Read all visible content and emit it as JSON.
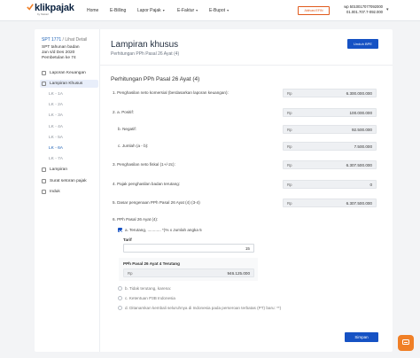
{
  "header": {
    "logo_text": "klikpajak",
    "logo_sub": "by Mekari",
    "nav": [
      {
        "label": "Home",
        "caret": false
      },
      {
        "label": "E-Billing",
        "caret": false
      },
      {
        "label": "Lapor Pajak",
        "caret": true
      },
      {
        "label": "E-Faktur",
        "caret": true
      },
      {
        "label": "E-Bupot",
        "caret": true
      }
    ],
    "aktivasi_label": "Aktivasi EFIN",
    "user_npwp_label": "wp 5010017077092000",
    "user_npwp_formatted": "01.001.707.7-092.000"
  },
  "sidebar": {
    "spt_link": "SPT 1771",
    "spt_suffix": " / Lihat Detail",
    "info_lines": [
      "SPT tahunan badan",
      "Jan s/d Des 2020",
      "Pembetulan ke 74"
    ],
    "items": [
      {
        "label": "Laporan Keuangan",
        "active": false
      },
      {
        "label": "Lampiran Khusus",
        "active": true
      }
    ],
    "sub_items": [
      {
        "label": "LK - 1A",
        "active": false
      },
      {
        "label": "LK - 2A",
        "active": false
      },
      {
        "label": "LK - 3A",
        "active": false
      },
      {
        "label": "LK - 4A",
        "active": false
      },
      {
        "label": "LK - 5A",
        "active": false
      },
      {
        "label": "LK - 6A",
        "active": true
      },
      {
        "label": "LK - 7A",
        "active": false
      }
    ],
    "bottom_items": [
      {
        "label": "Lampiran"
      },
      {
        "label": "Surat setoran pajak"
      },
      {
        "label": "Induk"
      }
    ]
  },
  "main": {
    "title": "Lampiran khusus",
    "subtitle": "Perhitungan PPh Pasal 26 Ayat (4)",
    "unduh_label": "Unduh BPE",
    "section_title": "Perhitungan PPh Pasal 26 Ayat (4)",
    "currency": "Rp",
    "rows": [
      {
        "label": "1. Penghasilan neto komersial (berdasarkan laporan keuangan):",
        "value": "6.300.000.000"
      },
      {
        "label": "2. a. Positif:",
        "value": "100.000.000"
      },
      {
        "label": "b. Negatif:",
        "value": "92.500.000"
      },
      {
        "label": "c. Jumlah (a - b):",
        "value": "7.500.000"
      },
      {
        "label": "3. Penghasilan neto fiskal (1+/-2c):",
        "value": "6.307.500.000"
      },
      {
        "label": "4. Pajak penghasilan badan terutang:",
        "value": "0"
      },
      {
        "label": "5. Dasar pengenaan PPh Pasal 26 Ayat (4) (3-4)",
        "value": "6.307.500.000"
      }
    ],
    "q6_label": "6. PPh Pasal 26 Ayat (4):",
    "option_a": "a. Terutang, ............ *)% x Jumlah angka 5",
    "tarif_label": "Tarif",
    "tarif_value": "15",
    "pph_label": "PPh Pasal 26 Ayat 4 Terutang",
    "pph_value": "946.125.000",
    "option_b": "b. Tidak terutang, karena:",
    "option_c": "c. Ketentuan P3B Indonesia",
    "option_d": "d. Ditanamkan kembali seluruhnya di Indonesia pada perseroan terbatas (PT) baru: **)",
    "simpan_label": "Simpan"
  },
  "colors": {
    "primary": "#1652c4",
    "accent_orange": "#f07f26",
    "active_bg": "#e8eefa"
  },
  "icons": [
    "chevron-down-icon",
    "document-icon",
    "chat-icon",
    "check-icon"
  ]
}
